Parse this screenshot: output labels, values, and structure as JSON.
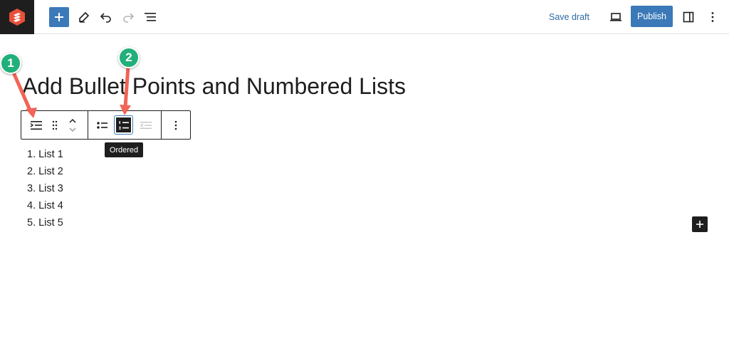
{
  "header": {
    "logo_icon": "publisher-logo-icon",
    "inserter_icon": "plus-icon",
    "tools": [
      "pencil-icon",
      "undo-icon",
      "redo-icon",
      "list-view-icon"
    ],
    "save_draft_label": "Save draft",
    "preview_icon": "laptop-icon",
    "publish_label": "Publish",
    "settings_icon": "sidebar-toggle-icon",
    "options_icon": "more-vertical-icon",
    "accent": "#3b79b9"
  },
  "editor": {
    "post_title": "Add Bullet Points and Numbered Lists",
    "block_toolbar": {
      "buttons": [
        "list-block-icon",
        "drag-handle-icon",
        "move-up-down-icon",
        "unordered-list-icon",
        "ordered-list-icon",
        "outdent-icon",
        "block-options-icon"
      ],
      "active": "ordered-list-icon"
    },
    "tooltip": "Ordered",
    "list_items": [
      "1. List 1",
      "2. List 2",
      "3. List 3",
      "4. List 4",
      "5. List 5"
    ],
    "block_add_icon": "plus-icon"
  },
  "annotations": {
    "badges": [
      "1",
      "2"
    ],
    "badge_color": "#22b07a",
    "arrow_color": "#f26456"
  }
}
